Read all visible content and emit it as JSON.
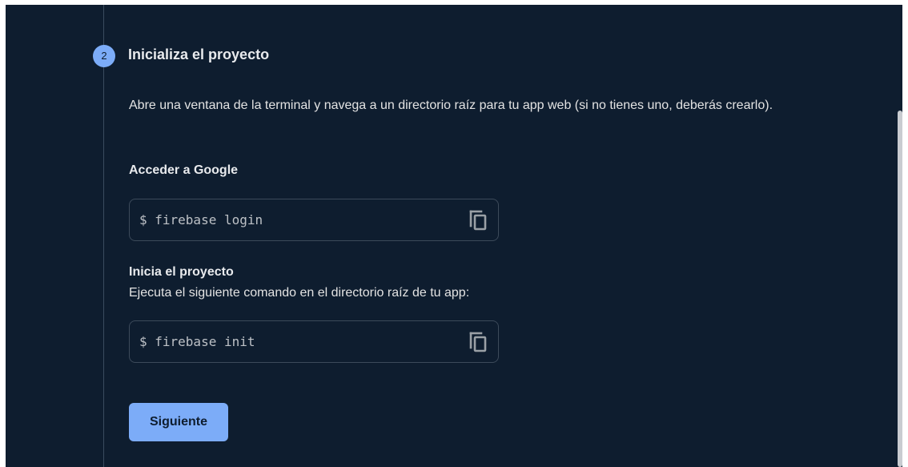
{
  "step": {
    "number": "2",
    "title": "Inicializa el proyecto",
    "description": "Abre una ventana de la terminal y navega a un directorio raíz para tu app web (si no tienes uno, deberás crearlo)."
  },
  "login_section": {
    "label": "Acceder a Google",
    "command": "$ firebase login",
    "copy_icon": "copy-icon"
  },
  "init_section": {
    "label": "Inicia el proyecto",
    "sublabel": "Ejecuta el siguiente comando en el directorio raíz de tu app:",
    "command": "$ firebase init",
    "copy_icon": "copy-icon"
  },
  "actions": {
    "next_label": "Siguiente"
  },
  "colors": {
    "background": "#0e1d2f",
    "accent": "#7cacf8",
    "text": "#e3e3e3"
  }
}
